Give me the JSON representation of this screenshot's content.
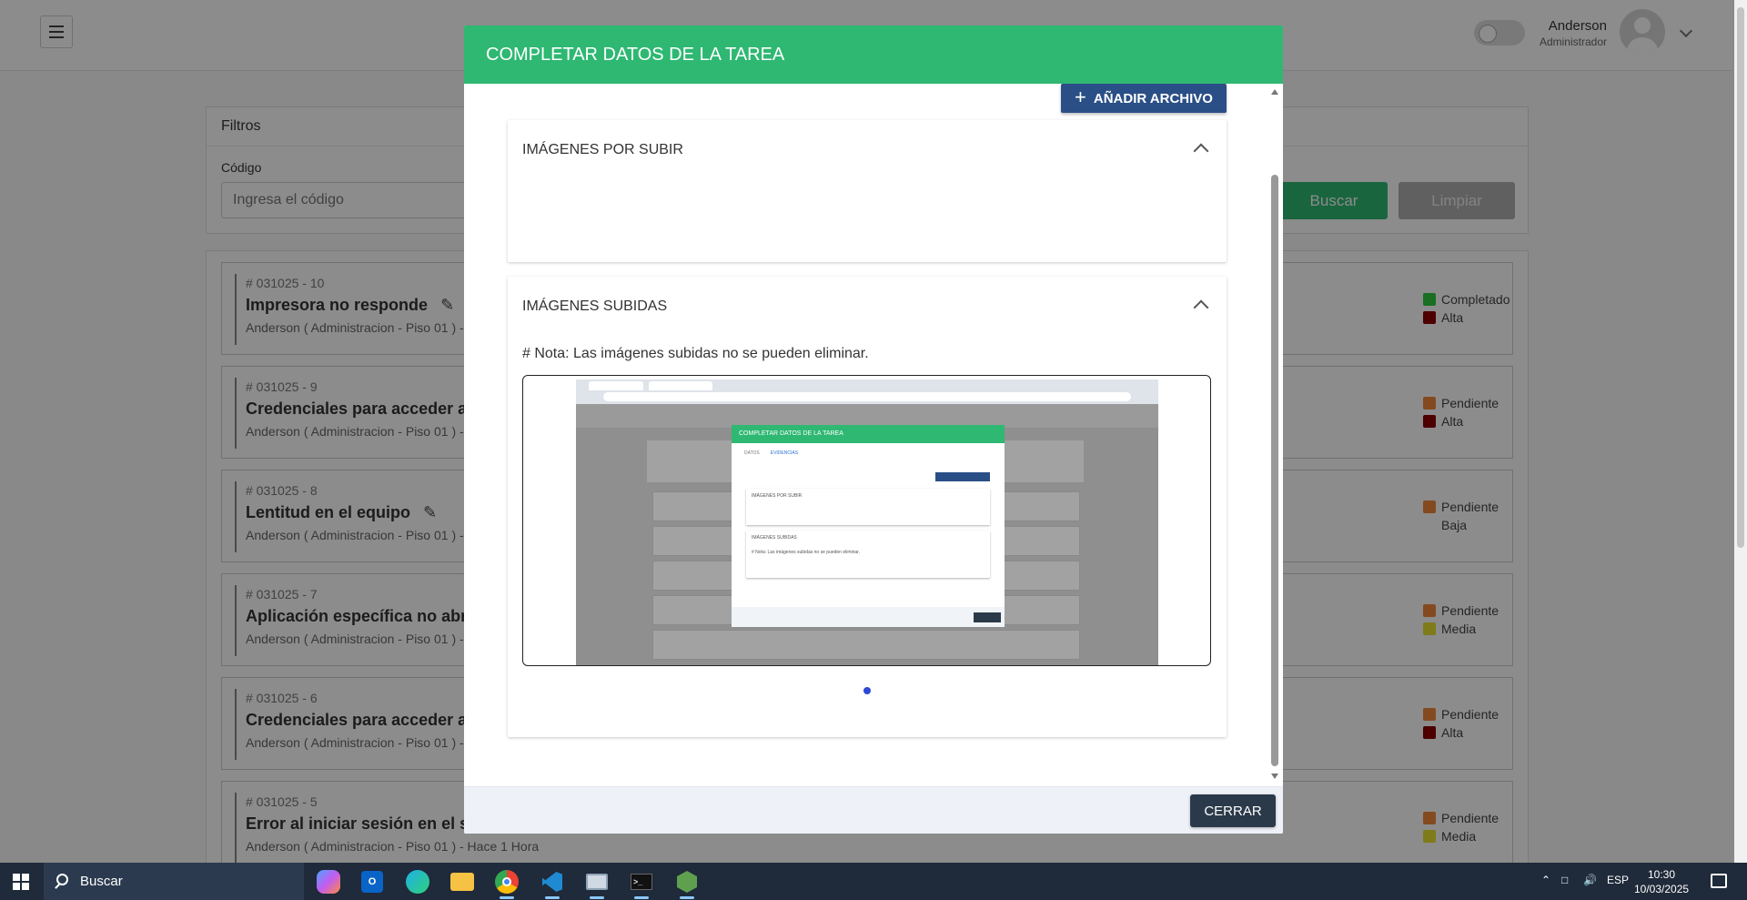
{
  "header": {
    "user_name": "Anderson",
    "user_role": "Administrador"
  },
  "filters": {
    "title": "Filtros",
    "code_label": "Código",
    "code_placeholder": "Ingresa el código",
    "search_label": "Buscar",
    "clear_label": "Limpiar"
  },
  "tasks": [
    {
      "code": "# 031025 - 10",
      "title": "Impresora no responde",
      "editable": true,
      "sub": "Anderson ( Administracion - Piso 01 ) -",
      "status": "Completado",
      "status_color": "#2ecc40",
      "priority": "Alta",
      "priority_color": "#8b0000"
    },
    {
      "code": "# 031025 - 9",
      "title": "Credenciales para acceder al",
      "editable": false,
      "sub": "Anderson ( Administracion - Piso 01 ) -",
      "status": "Pendiente",
      "status_color": "#f0883a",
      "priority": "Alta",
      "priority_color": "#8b0000"
    },
    {
      "code": "# 031025 - 8",
      "title": "Lentitud en el equipo",
      "editable": true,
      "sub": "Anderson ( Administracion - Piso 01 ) -",
      "status": "Pendiente",
      "status_color": "#f0883a",
      "priority": "Baja",
      "priority_color": ""
    },
    {
      "code": "# 031025 - 7",
      "title": "Aplicación específica no abre",
      "editable": false,
      "sub": "Anderson ( Administracion - Piso 01 ) -",
      "status": "Pendiente",
      "status_color": "#f0883a",
      "priority": "Media",
      "priority_color": "#e8e030"
    },
    {
      "code": "# 031025 - 6",
      "title": "Credenciales para acceder al",
      "editable": false,
      "sub": "Anderson ( Administracion - Piso 01 ) -",
      "status": "Pendiente",
      "status_color": "#f0883a",
      "priority": "Alta",
      "priority_color": "#8b0000"
    },
    {
      "code": "# 031025 - 5",
      "title": "Error al iniciar sesión en el sis",
      "editable": false,
      "sub": "Anderson ( Administracion - Piso 01 ) - Hace 1 Hora",
      "status": "Pendiente",
      "status_color": "#f0883a",
      "priority": "Media",
      "priority_color": "#e8e030"
    }
  ],
  "modal": {
    "title": "COMPLETAR DATOS DE LA TAREA",
    "add_file_label": "AÑADIR ARCHIVO",
    "pending_panel_title": "IMÁGENES POR SUBIR",
    "uploaded_panel_title": "IMÁGENES SUBIDAS",
    "note": "# Nota: Las imágenes subidas no se pueden eliminar.",
    "close_label": "CERRAR"
  },
  "thumbnail": {
    "modal_title": "COMPLETAR DATOS DE LA TAREA",
    "tab_datos": "DATOS",
    "tab_evidencias": "EVIDENCIAS",
    "pending": "IMÁGENES POR SUBIR",
    "uploaded": "IMÁGENES SUBIDAS",
    "note": "# Nota: Las imágenes subidas no se pueden eliminar."
  },
  "taskbar": {
    "search_label": "Buscar",
    "language": "ESP",
    "time": "10:30",
    "date": "10/03/2025"
  },
  "colors": {
    "brand_green": "#2eb872",
    "primary_blue": "#2a4f86",
    "dark_button": "#2b3a4a"
  }
}
